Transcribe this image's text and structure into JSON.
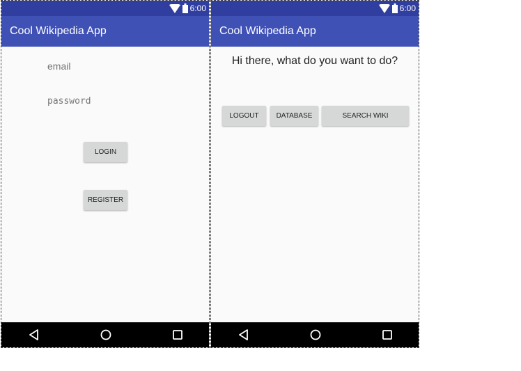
{
  "status_bar": {
    "time": "6:00"
  },
  "login_screen": {
    "app_title": "Cool Wikipedia App",
    "email_placeholder": "email",
    "password_placeholder": "password",
    "login_label": "LOGIN",
    "register_label": "REGISTER"
  },
  "home_screen": {
    "app_title": "Cool Wikipedia App",
    "greeting": "Hi there, what do you want to do?",
    "logout_label": "LOGOUT",
    "database_label": "DATABASE",
    "search_wiki_label": "SEARCH WIKI"
  },
  "icons": {
    "status": [
      "wifi-icon",
      "battery-icon"
    ],
    "nav": [
      "back-icon",
      "home-icon",
      "recents-icon"
    ]
  },
  "colors": {
    "status_bar": "#303f9f",
    "app_bar": "#3f51b5",
    "nav_bar": "#000000",
    "button": "#d6d7d7",
    "background": "#fafafa"
  }
}
